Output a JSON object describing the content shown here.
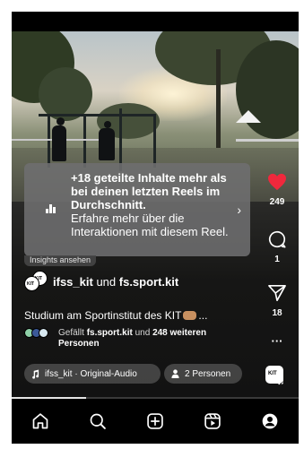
{
  "insight_card": {
    "title": "+18 geteilte Inhalte mehr als bei deinen letzten Reels im Durchschnitt.",
    "subtitle": "Erfahre mehr über die Interaktionen mit diesem Reel."
  },
  "insights_pill": "Insights ansehen",
  "rail": {
    "likes": "249",
    "comments": "1",
    "shares": "18",
    "more": "···"
  },
  "account": {
    "user1": "ifss_kit",
    "joiner": "und",
    "user2": "fs.sport.kit"
  },
  "caption": {
    "text": "Studium am Sportinstitut des KIT",
    "ellipsis": "..."
  },
  "likes_row": {
    "prefix": "Gefällt",
    "user": "fs.sport.kit",
    "joiner": "und",
    "count": "248 weiteren",
    "suffix": "Personen"
  },
  "audio_chip": "ifss_kit · Original-Audio",
  "people_chip": "2 Personen",
  "avatar_text": "KIT",
  "progress": 0.26,
  "colors": {
    "heart": "#f0283c",
    "card_bg": "#6e6e70",
    "background": "#000000"
  },
  "tabs": [
    "home-icon",
    "search-icon",
    "create-icon",
    "reels-icon",
    "profile-icon"
  ]
}
